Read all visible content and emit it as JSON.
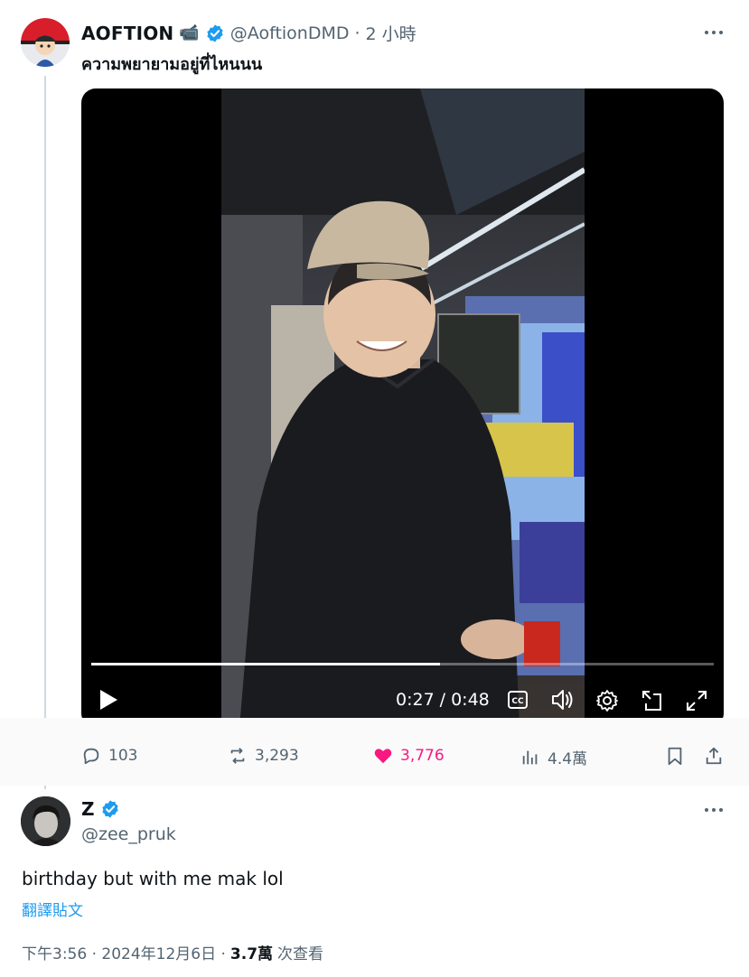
{
  "first_tweet": {
    "display_name": "AOFTION",
    "name_emoji": "📹",
    "handle": "@AoftionDMD",
    "time_separator": "·",
    "time": "2 小時",
    "text": "ความพยายามอยู่ที่ไหนนน",
    "video": {
      "current_time": "0:27",
      "duration": "0:48",
      "progress": 0.56
    },
    "stats": {
      "replies": "103",
      "reposts": "3,293",
      "likes": "3,776",
      "views": "4.4萬"
    }
  },
  "reply_tweet": {
    "display_name": "Z",
    "handle": "@zee_pruk",
    "text": "birthday but with me mak lol",
    "translate_label": "翻譯貼文",
    "timestamp": "下午3:56 · 2024年12月6日 ·",
    "views_count": "3.7萬",
    "views_label": "次查看"
  },
  "colors": {
    "verified": "#1d9bf0",
    "like": "#f91880",
    "muted": "#536471",
    "link": "#1d9bf0"
  }
}
